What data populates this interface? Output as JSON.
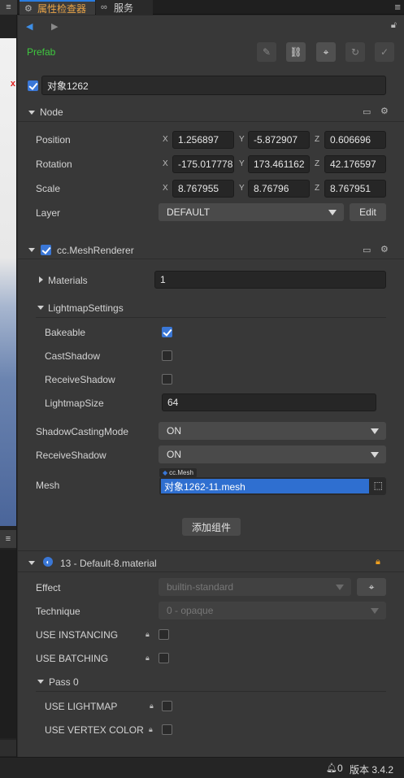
{
  "tabs": [
    {
      "label": "属性检查器",
      "icon": "gear-icon",
      "active": true
    },
    {
      "label": "服务",
      "icon": "link-icon",
      "active": false
    }
  ],
  "prefab_label": "Prefab",
  "node_name": "对象1262",
  "node_section": {
    "title": "Node",
    "position": {
      "label": "Position",
      "x": "1.256897",
      "y": "-5.872907",
      "z": "0.606696"
    },
    "rotation": {
      "label": "Rotation",
      "x": "-175.017778",
      "y": "173.461162",
      "z": "42.176597"
    },
    "scale": {
      "label": "Scale",
      "x": "8.767955",
      "y": "8.76796",
      "z": "8.767951"
    },
    "layer": {
      "label": "Layer",
      "value": "DEFAULT",
      "edit_label": "Edit"
    }
  },
  "axis_labels": {
    "x": "X",
    "y": "Y",
    "z": "Z"
  },
  "mesh_renderer": {
    "title": "cc.MeshRenderer",
    "materials_label": "Materials",
    "materials_value": "1",
    "lightmap_settings_label": "LightmapSettings",
    "bakeable_label": "Bakeable",
    "cast_shadow_label": "CastShadow",
    "receive_shadow_label": "ReceiveShadow",
    "lightmap_size_label": "LightmapSize",
    "lightmap_size_value": "64",
    "shadow_casting_mode_label": "ShadowCastingMode",
    "shadow_casting_mode_value": "ON",
    "receive_shadow_mode_label": "ReceiveShadow",
    "receive_shadow_mode_value": "ON",
    "mesh_label": "Mesh",
    "mesh_type_badge": "cc.Mesh",
    "mesh_value": "对象1262-11.mesh"
  },
  "add_component_label": "添加组件",
  "material": {
    "title": "13 - Default-8.material",
    "effect_label": "Effect",
    "effect_value": "builtin-standard",
    "technique_label": "Technique",
    "technique_value": "0 - opaque",
    "use_instancing_label": "USE INSTANCING",
    "use_batching_label": "USE BATCHING",
    "pass_label": "Pass 0",
    "use_lightmap_label": "USE LIGHTMAP",
    "use_vertex_color_label": "USE VERTEX COLOR"
  },
  "status": {
    "notifications": "0",
    "version": "版本 3.4.2"
  },
  "colors": {
    "accent": "#3a77d6",
    "prefab": "#3fc93f",
    "active_tab": "#e9a447",
    "lock": "#f0a020"
  }
}
